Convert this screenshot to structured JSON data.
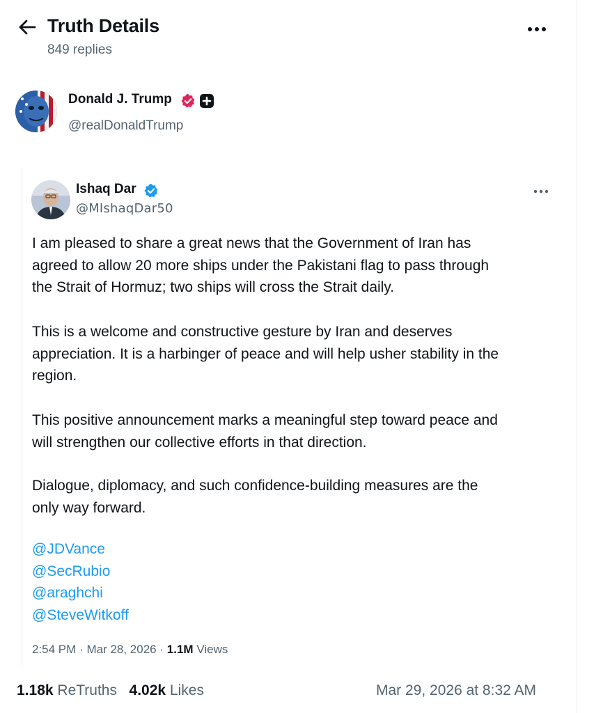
{
  "header": {
    "title": "Truth Details",
    "replies": "849 replies",
    "icons": {
      "back": "arrow-left-icon",
      "more": "more-horizontal-icon"
    }
  },
  "author": {
    "name": "Donald J. Trump",
    "handle": "@realDonaldTrump",
    "badges": [
      "verified-badge-icon",
      "plus-badge-icon"
    ],
    "badge_color": "#e0245e"
  },
  "embedded_post": {
    "name": "Ishaq Dar",
    "handle": "@MIshaqDar50",
    "verified_color": "#1d9bf0",
    "paragraphs": [
      [
        "I am pleased to share a great news that the Government of Iran has",
        "agreed to allow 20 more ships under the Pakistani flag to pass through",
        "the Strait of Hormuz; two ships will cross the Strait daily."
      ],
      [
        "This is a welcome and constructive gesture by Iran and deserves",
        "appreciation. It is a harbinger of peace and will help usher stability in the",
        "region."
      ],
      [
        "This positive announcement marks a meaningful step toward peace and",
        "will strengthen our collective efforts in that direction."
      ],
      [
        "Dialogue, diplomacy, and such confidence-building measures are the",
        "only way forward."
      ]
    ],
    "mentions": [
      "@JDVance",
      "@SecRubio",
      "@araghchi",
      "@SteveWitkoff"
    ],
    "time": "2:54 PM",
    "date": "Mar 28, 2026",
    "views_count": "1.1M",
    "views_label": "Views",
    "separator": "·"
  },
  "footer": {
    "retruths_count": "1.18k",
    "retruths_label": "ReTruths",
    "likes_count": "4.02k",
    "likes_label": "Likes",
    "timestamp": "Mar 29, 2026 at 8:32 AM"
  },
  "colors": {
    "link": "#1d9bf0",
    "secondary_text": "#536471",
    "primary_text": "#0f1419"
  }
}
